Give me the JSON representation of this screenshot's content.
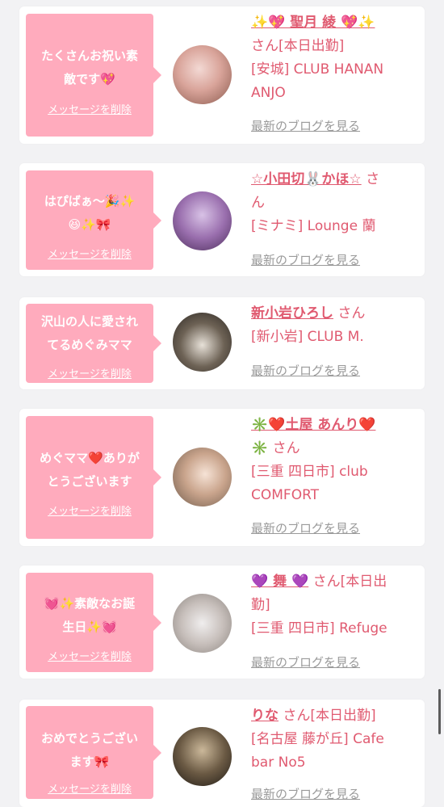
{
  "delete_label": "メッセージを削除",
  "blog_label": "最新のブログを見る",
  "colors": {
    "bubble": "#ffabbd",
    "accent": "#e05a70",
    "link_gray": "#9a9a9a"
  },
  "cards": [
    {
      "message_lines": [
        "たくさんお祝い素",
        "敵です💖"
      ],
      "name": "✨💖 聖月 綾 💖✨",
      "after_name": "",
      "info_lines": [
        "さん[本日出勤]",
        "[安城] CLUB HANAN",
        "ANJO"
      ]
    },
    {
      "message_lines": [
        "はぴばぁ〜🎉✨",
        "😆✨🎀"
      ],
      "name": "☆小田切🐰かほ☆",
      "after_name": "さ",
      "info_lines": [
        "ん",
        "[ミナミ] Lounge 蘭"
      ]
    },
    {
      "message_lines": [
        "沢山の人に愛され",
        "てるめぐみママ"
      ],
      "name": "新小岩ひろし",
      "after_name": "さん",
      "info_lines": [
        "[新小岩] CLUB M."
      ]
    },
    {
      "message_lines": [
        "めぐママ❤️ありが",
        "とうございます"
      ],
      "name": "✳️❤️土屋 あんり❤️",
      "after_name": "",
      "info_lines": [
        "✳️ さん",
        "[三重 四日市] club",
        "COMFORT"
      ]
    },
    {
      "message_lines": [
        "💓✨素敵なお誕",
        "生日✨💓"
      ],
      "name": "💜 舞 💜",
      "after_name": "さん[本日出",
      "info_lines": [
        "勤]",
        "[三重 四日市] Refuge"
      ]
    },
    {
      "message_lines": [
        "おめでとうござい",
        "ます🎀"
      ],
      "name": "りな",
      "after_name": "さん[本日出勤]",
      "info_lines": [
        "[名古屋 藤が丘] Cafe",
        "bar No5"
      ]
    }
  ]
}
